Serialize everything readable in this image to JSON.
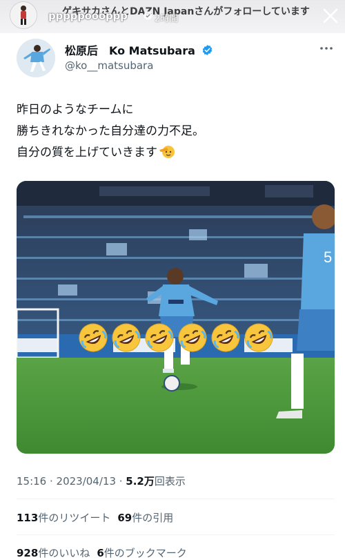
{
  "story": {
    "handle": "pppppoooppp",
    "time": "2時間",
    "notice": "ゲキサカさんとDAZN Japanさんがフォローしています"
  },
  "tweet": {
    "display_name": "松原后　Ko Matsubara",
    "handle": "@ko__matsubara",
    "text_lines": [
      "昨日のようなチームに",
      "勝ちきれなかった自分達の力不足。",
      "自分の質を上げていきます"
    ],
    "overlay_emojis": [
      "rolling-on-floor-laughing",
      "rolling-on-floor-laughing",
      "rolling-on-floor-laughing",
      "rolling-on-floor-laughing",
      "rolling-on-floor-laughing",
      "rolling-on-floor-laughing"
    ],
    "timestamp": "15:16 · 2023/04/13 · ",
    "views_count": "5.2万",
    "views_label": "回表示",
    "retweets": {
      "count": "113",
      "label": "件のリツイート"
    },
    "quotes": {
      "count": "69",
      "label": "件の引用"
    },
    "likes": {
      "count": "928",
      "label": "件のいいね"
    },
    "bookmarks": {
      "count": "6",
      "label": "件のブックマーク"
    }
  },
  "colors": {
    "verified_blue": "#1d9bf0",
    "text_primary": "#0f1419",
    "text_secondary": "#536471",
    "pitch_green": "#4f9a3e",
    "jersey_blue": "#5aa6df"
  }
}
